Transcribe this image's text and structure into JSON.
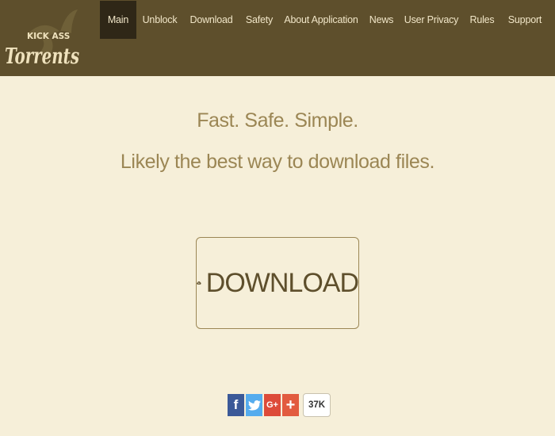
{
  "site": {
    "logo_text_top": "KICK ASS",
    "logo_text_main": "Torrents"
  },
  "nav": {
    "items": [
      {
        "label": "Main",
        "active": true
      },
      {
        "label": "Unblock",
        "active": false
      },
      {
        "label": "Download",
        "active": false
      },
      {
        "label": "Safety",
        "active": false
      },
      {
        "label": "About Application",
        "active": false
      },
      {
        "label": "News",
        "active": false
      },
      {
        "label": "User Privacy",
        "active": false
      },
      {
        "label": "Rules",
        "active": false
      },
      {
        "label": "Support",
        "active": false
      }
    ]
  },
  "hero": {
    "tagline": "Fast. Safe. Simple.",
    "subtitle": "Likely the best way to download files.",
    "download_label": "DOWNLOAD"
  },
  "share": {
    "buttons": [
      {
        "name": "facebook-share-button",
        "icon": "facebook-icon",
        "glyph": "f"
      },
      {
        "name": "twitter-share-button",
        "icon": "twitter-icon",
        "glyph": ""
      },
      {
        "name": "google-plus-share-button",
        "icon": "google-plus-icon",
        "glyph": "G+"
      },
      {
        "name": "more-share-button",
        "icon": "plus-icon",
        "glyph": "+"
      }
    ],
    "count": "37K"
  },
  "colors": {
    "header_bg": "#5e4f2c",
    "nav_active_bg": "#2f2717",
    "page_bg": "#f6efd9",
    "text_gold": "#9b8654",
    "download_text": "#5e4f2c",
    "facebook": "#3b5998",
    "twitter": "#55acee",
    "google_plus": "#dd4b39",
    "share_more": "#e25b3f"
  }
}
